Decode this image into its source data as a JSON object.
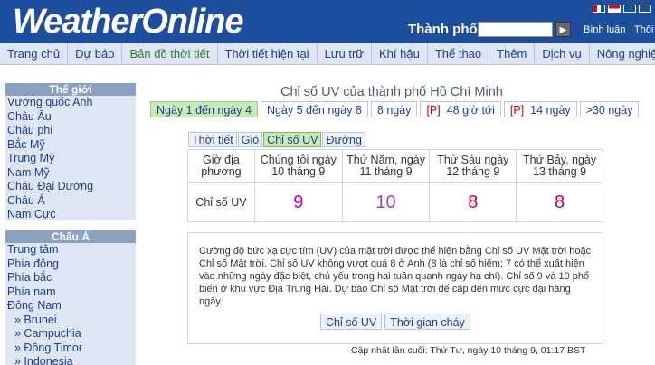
{
  "header": {
    "logo": "WeatherOnline",
    "city_label": "Thành phố:",
    "city_value": "",
    "go_icon": "play-arrow-icon",
    "links": [
      "Bình luận",
      "Thôi"
    ],
    "flag_colors": [
      "#c8102e",
      "#ffffff",
      "#0055a4",
      "#1e4f9e"
    ]
  },
  "nav": [
    "Trang chủ",
    "Dự báo",
    "Bản đồ thời tiết",
    "Thời tiết hiện tại",
    "Lưu trữ",
    "Khí hậu",
    "Thể thao",
    "Thêm",
    "Dịch vụ",
    "Nông nghiệp"
  ],
  "sidebar": {
    "world": {
      "heading": "Thế giới",
      "items": [
        "Vương quốc Anh",
        "Châu Âu",
        "Châu phi",
        "Bắc Mỹ",
        "Trung Mỹ",
        "Nam Mỹ",
        "Châu Đại Dương",
        "Châu Á",
        "Nam Cực"
      ]
    },
    "asia": {
      "heading": "Châu Á",
      "items": [
        "Trung tâm",
        "Phía đông",
        "Phía bắc",
        "Phía nam",
        "Đông Nam"
      ],
      "subitems": [
        "» Brunei",
        "» Campuchia",
        "» Đông Timor",
        "» Indonesia"
      ]
    }
  },
  "main": {
    "title": "Chỉ số UV của thành phố Hồ Chí Minh",
    "day_tabs": [
      {
        "label": "Ngày 1 đến ngày 4",
        "active": true
      },
      {
        "label": "Ngày 5 đến ngày 8",
        "active": false
      },
      {
        "label": "8 ngày",
        "active": false
      },
      {
        "prefix": "[P]",
        "label": "48 giờ tới",
        "active": false
      },
      {
        "prefix": "[P]",
        "label": "14 ngày",
        "active": false
      },
      {
        "label": ">30 ngày",
        "active": false
      }
    ],
    "type_tabs": [
      "Thời tiết",
      "Gió",
      "Chỉ số UV",
      "Đường"
    ],
    "table": {
      "header": [
        "Giờ địa phương",
        "Chúng tôi ngày 10 tháng 9",
        "Thứ Năm, ngày 11 tháng 9",
        "Thứ Sáu ngày 12 tháng 9",
        "Thứ Bảy, ngày 13 tháng 9"
      ],
      "row_label": "Chỉ số UV",
      "values": [
        {
          "value": "9",
          "color": "#c400c4"
        },
        {
          "value": "10",
          "color": "#a040d0"
        },
        {
          "value": "8",
          "color": "#d0003a"
        },
        {
          "value": "8",
          "color": "#d0003a"
        }
      ]
    },
    "info": {
      "text": "Cường độ bức xạ cực tím (UV) của mặt trời được thể hiện bằng Chỉ số UV Mặt trời hoặc Chỉ số Mặt trời. Chỉ số UV không vượt quá 8 ở Anh (8 là chỉ số hiếm; 7 có thể xuất hiện vào những ngày đặc biệt, chủ yếu trong hai tuần quanh ngày hạ chí). Chỉ số 9 và 10 phổ biến ở khu vực Địa Trung Hải. Dự báo Chỉ số Mặt trời để cập đến mức cực đại hàng ngày.",
      "buttons": [
        "Chỉ số UV",
        "Thời gian cháy"
      ]
    },
    "updated": "Cập nhật lần cuối: Thứ Tư, ngày 10 tháng 9, 01:17 BST"
  }
}
